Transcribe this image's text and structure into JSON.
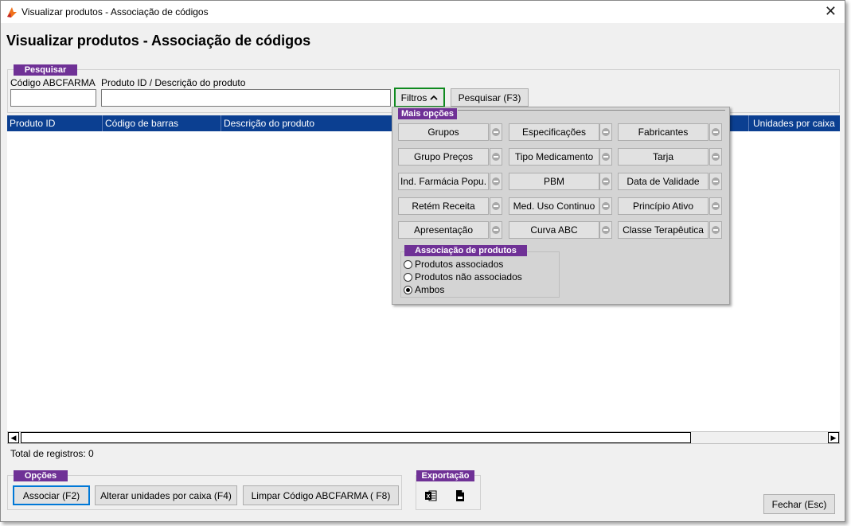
{
  "window": {
    "title": "Visualizar produtos - Associação de códigos",
    "close_glyph": "✕"
  },
  "page_title": "Visualizar produtos - Associação de códigos",
  "search": {
    "group_label": "Pesquisar",
    "abcfarma_label": "Código ABCFARMA",
    "abcfarma_value": "",
    "produto_label": "Produto ID / Descrição do produto",
    "produto_value": "",
    "filtros_label": "Filtros",
    "pesquisar_label": "Pesquisar (F3)"
  },
  "grid": {
    "columns": [
      "Produto ID",
      "Código de barras",
      "Descrição do produto",
      "Unidades por caixa"
    ]
  },
  "filters_popup": {
    "section_label": "Mais opções",
    "buttons": [
      "Grupos",
      "Especificações",
      "Fabricantes",
      "Grupo Preços",
      "Tipo Medicamento",
      "Tarja",
      "Ind. Farmácia Popu.",
      "PBM",
      "Data de Validade",
      "Retém Receita",
      "Med. Uso Continuo",
      "Princípio Ativo",
      "Apresentação",
      "Curva ABC",
      "Classe Terapêutica"
    ],
    "association_label": "Associação de produtos",
    "radio_options": [
      "Produtos associados",
      "Produtos não associados",
      "Ambos"
    ],
    "selected_radio": "Ambos"
  },
  "total_registros": "Total de registros: 0",
  "opcoes": {
    "group_label": "Opções",
    "associar_label": "Associar (F2)",
    "alterar_label": "Alterar unidades por caixa (F4)",
    "limpar_label": "Limpar Código ABCFARMA ( F8)"
  },
  "exportacao": {
    "group_label": "Exportação",
    "icons": [
      "excel-icon",
      "txt-file-icon"
    ]
  },
  "fechar_label": "Fechar (Esc)",
  "colors": {
    "accent_purple": "#6f3196",
    "grid_header_blue": "#0b3f91",
    "filtros_border_green": "#0f8a1f"
  }
}
